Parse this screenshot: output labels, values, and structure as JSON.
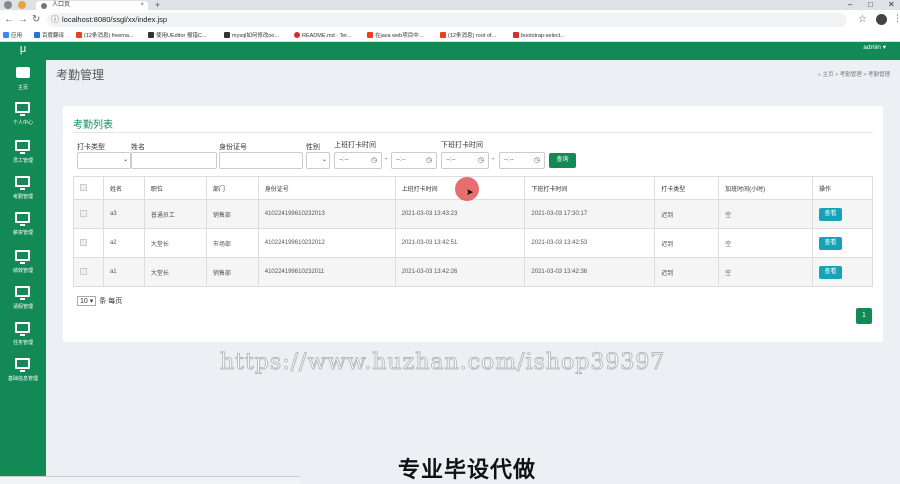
{
  "browser": {
    "tab_title": "人口页",
    "tab_close": "×",
    "new_tab": "+",
    "url": "localhost:8080/ssgl/xx/index.jsp",
    "window_controls": {
      "minimize": "–",
      "maximize": "□",
      "close": "✕"
    },
    "bookmarks": [
      {
        "label": "应用",
        "color": "#4285f4"
      },
      {
        "label": "百度翻译",
        "color": "#2b6fdb"
      },
      {
        "label": "(12条消息) freema...",
        "color": "#e8401c"
      },
      {
        "label": "使用UEditor 报错C...",
        "color": "#333333"
      },
      {
        "label": "mysql如何修改oo...",
        "color": "#333333"
      },
      {
        "label": "README.md · Ter...",
        "color": "#d32f2f"
      },
      {
        "label": "在java web项目中...",
        "color": "#e8401c"
      },
      {
        "label": "(12条消息) root of...",
        "color": "#e8401c"
      },
      {
        "label": "bootstrap-select...",
        "color": "#d32f2f"
      }
    ]
  },
  "app": {
    "brand": "μ",
    "admin": "admin ▾",
    "accent": "#138a55",
    "sidebar": [
      {
        "label": "主页",
        "icon": "home-icon"
      },
      {
        "label": "个人中心",
        "icon": "monitor-icon"
      },
      {
        "label": "员工管理",
        "icon": "monitor-icon"
      },
      {
        "label": "考勤管理",
        "icon": "monitor-icon"
      },
      {
        "label": "薪资管理",
        "icon": "monitor-icon"
      },
      {
        "label": "绩效管理",
        "icon": "monitor-icon"
      },
      {
        "label": "请假管理",
        "icon": "monitor-icon"
      },
      {
        "label": "任务管理",
        "icon": "monitor-icon"
      },
      {
        "label": "基础信息管理",
        "icon": "monitor-icon"
      }
    ]
  },
  "page": {
    "title": "考勤管理",
    "breadcrumb": "⌂ 主页  >  考勤管理  >  考勤管理"
  },
  "card": {
    "title": "考勤列表",
    "filters": {
      "type_label": "打卡类型",
      "name_label": "姓名",
      "id_label": "身份证号",
      "gender_label": "性别",
      "checkin_label": "上班打卡时间",
      "checkout_label": "下班打卡时间",
      "time_placeholder": "--:--",
      "dash": "-",
      "search_btn": "查询"
    },
    "table": {
      "headers": [
        "姓名",
        "职位",
        "部门",
        "身份证号",
        "上班打卡时间",
        "下班打卡时间",
        "打卡类型",
        "加班时间(小时)",
        "操作"
      ],
      "rows": [
        {
          "name": "a3",
          "position": "普通员工",
          "dept": "销售部",
          "id": "410224199610232013",
          "checkin": "2021-03-03 13:43:23",
          "checkout": "2021-03-03 17:30:17",
          "type": "迟到",
          "overtime": "空",
          "action": "查看"
        },
        {
          "name": "a2",
          "position": "大堂长",
          "dept": "市场部",
          "id": "410224199610232012",
          "checkin": "2021-03-03 13:42:51",
          "checkout": "2021-03-03 13:42:53",
          "type": "迟到",
          "overtime": "空",
          "action": "查看"
        },
        {
          "name": "a1",
          "position": "大堂长",
          "dept": "销售部",
          "id": "410224199610232011",
          "checkin": "2021-03-03 13:42:26",
          "checkout": "2021-03-03 13:42:36",
          "type": "迟到",
          "overtime": "空",
          "action": "查看"
        }
      ]
    },
    "page_size_value": "10 ▾",
    "page_size_suffix": "条 每页",
    "current_page": "1"
  },
  "overlay": {
    "watermark_url": "https://www.huzhan.com/ishop39397",
    "watermark_cn": "专业毕设代做"
  }
}
